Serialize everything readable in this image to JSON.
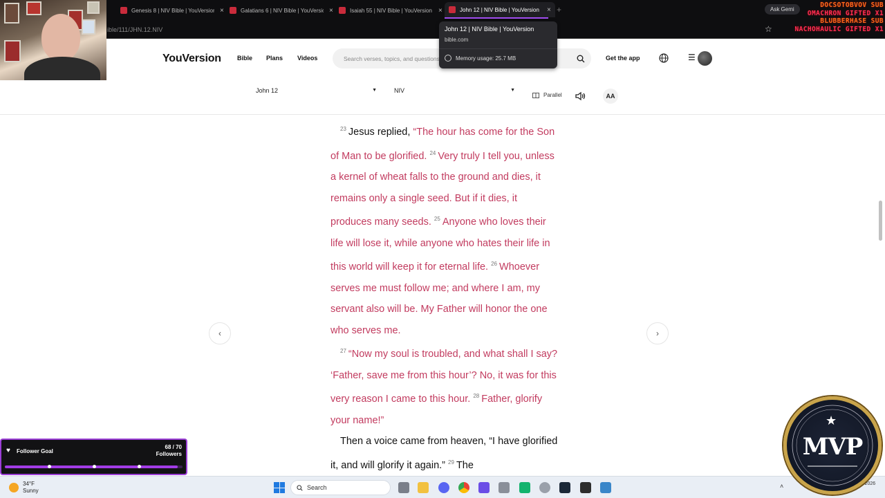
{
  "browser": {
    "tabs": [
      {
        "label": "Genesis 8 | NIV Bible | YouVersion"
      },
      {
        "label": "Galatians 6 | NIV Bible | YouVersion"
      },
      {
        "label": "Isaiah 55 | NIV Bible | YouVersion"
      },
      {
        "label": "John 12 | NIV Bible | YouVersion"
      }
    ],
    "url": "ible/111/JHN.12.NIV",
    "ask_gemini": "Ask Gemi",
    "tooltip": {
      "title": "John 12 | NIV Bible | YouVersion",
      "domain": "bible.com",
      "memory": "Memory usage: 25.7 MB"
    }
  },
  "overlay": {
    "sub_alerts": [
      "DOCSOTOBVOV SUB",
      "OMACHRON GIFTED X1",
      "BLUBBERHASE SUB",
      "NACHOHAULIC GIFTED X1"
    ],
    "follower_goal": {
      "title": "Follower Goal",
      "count": "68 / 70",
      "unit": "Followers",
      "progress": 0.971
    },
    "badge": {
      "word": "MVP",
      "ring": "MY VETERAN PASSION"
    }
  },
  "site": {
    "logo": "YouVersion",
    "nav": {
      "bible": "Bible",
      "plans": "Plans",
      "videos": "Videos"
    },
    "search_placeholder": "Search verses, topics, and questions",
    "get_app": "Get the app"
  },
  "toolbar": {
    "book": "John 12",
    "version": "NIV",
    "parallel": "Parallel",
    "font_btn": "AA"
  },
  "passage": {
    "v23_num": "23",
    "v23_a": "Jesus replied,",
    "v23_b": "“The hour has come for the Son of Man to be glorified.",
    "v24_num": "24",
    "v24": "Very truly I tell you, unless a kernel of wheat falls to the ground and dies, it remains only a single seed. But if it dies, it produces many seeds.",
    "v25_num": "25",
    "v25": "Anyone who loves their life will lose it, while anyone who hates their life in this world will keep it for eternal life.",
    "v26_num": "26",
    "v26": "Whoever serves me must follow me; and where I am, my servant also will be. My Father will honor the one who serves me.",
    "v27_num": "27",
    "v27": "“Now my soul is troubled, and what shall I say? ‘Father, save me from this hour’? No, it was for this very reason I came to this hour.",
    "v28_num": "28",
    "v28": "Father, glorify your name!”",
    "v28b": "Then a voice came from heaven, “I have glorified it, and will glorify it again.”",
    "v29_num": "29",
    "v29": "The"
  },
  "taskbar": {
    "weather_temp": "34°F",
    "weather_cond": "Sunny",
    "search": "Search",
    "clock": "3/16/2026"
  },
  "colors": {
    "jesus_words": "#c23b5f",
    "accent": "#a23ce6",
    "badge_gold": "#c9a44a"
  }
}
